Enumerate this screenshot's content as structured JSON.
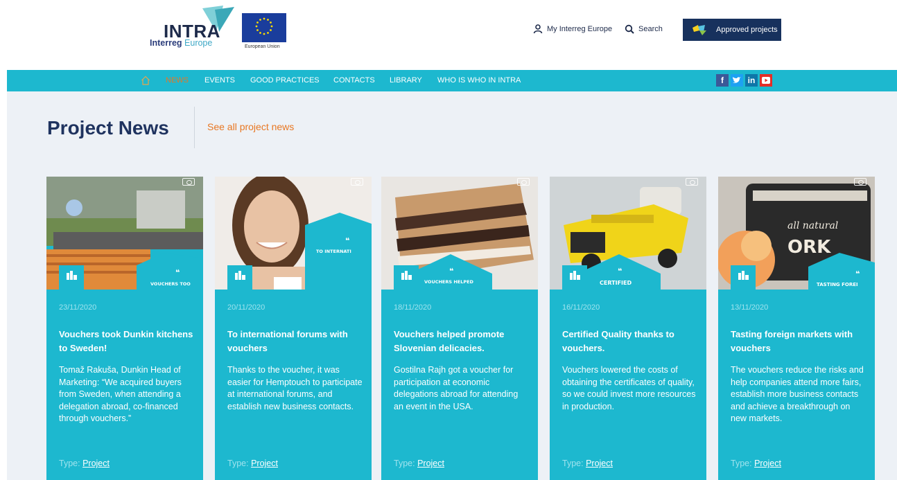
{
  "header": {
    "logo_word": "INTRA",
    "logo_sub_bold": "Interreg",
    "logo_sub_light": "Europe",
    "eu_label": "European Union",
    "my_interreg": "My Interreg Europe",
    "search": "Search",
    "approved_projects": "Approved projects"
  },
  "nav": {
    "items": [
      "NEWS",
      "EVENTS",
      "GOOD PRACTICES",
      "CONTACTS",
      "LIBRARY",
      "WHO IS WHO IN INTRA"
    ],
    "active": "NEWS"
  },
  "social": {
    "facebook": "f",
    "twitter": "t",
    "linkedin": "in",
    "youtube": "▶"
  },
  "main": {
    "title": "Project News",
    "see_all": "See all project news"
  },
  "type_label": "Type:",
  "cards": [
    {
      "date": "23/11/2020",
      "title": "Vouchers took Dunkin kitchens to Sweden!",
      "desc": "Tomaž Rakuša, Dunkin Head of Marketing: “We acquired buyers from Sweden, when attending a delegation abroad, co-financed through vouchers.”",
      "type_value": "Project",
      "badge": "VOUCHERS TOO"
    },
    {
      "date": "20/11/2020",
      "title": "To international forums with vouchers",
      "desc": "Thanks to the voucher, it was easier for Hemptouch to participate at international forums, and establish new business contacts.",
      "type_value": "Project",
      "badge": "TO INTERNATI"
    },
    {
      "date": "18/11/2020",
      "title": "Vouchers helped promote Slovenian delicacies.",
      "desc": "Gostilna Rajh got a voucher for participation at economic delegations abroad for attending an event in the USA.",
      "type_value": "Project",
      "badge": "VOUCHERS HELPED"
    },
    {
      "date": "16/11/2020",
      "title": "Certified Quality thanks to vouchers.",
      "desc": "Vouchers lowered the costs of obtaining the certificates of quality, so we could invest more resources in production.",
      "type_value": "Project",
      "badge": "CERTIFIED"
    },
    {
      "date": "13/11/2020",
      "title": "Tasting foreign markets with vouchers",
      "desc": "The vouchers reduce the risks and help companies attend more fairs, establish more business contacts and achieve a breakthrough on new markets.",
      "type_value": "Project",
      "badge": "TASTING FOREI"
    }
  ],
  "colors": {
    "accent": "#1db8cf",
    "navy": "#1f335f",
    "orange": "#e87722"
  }
}
